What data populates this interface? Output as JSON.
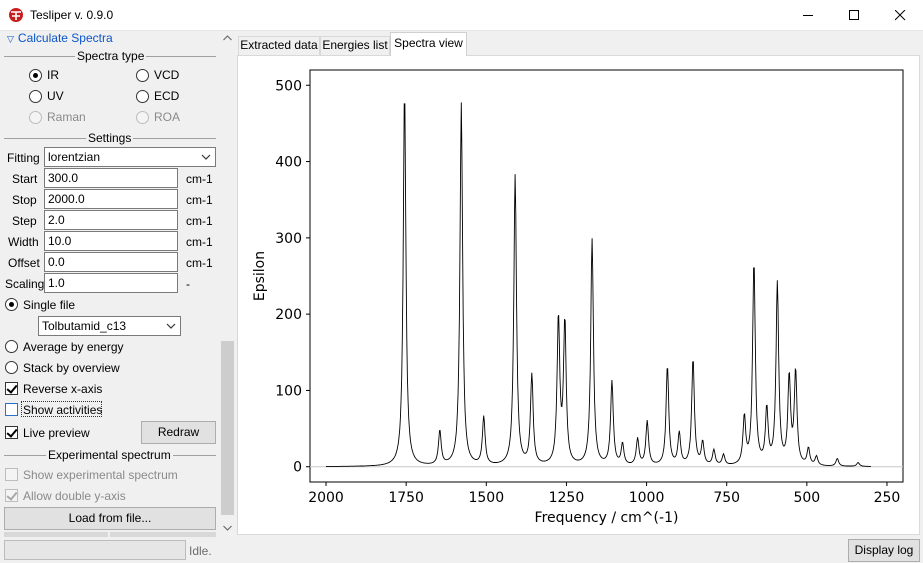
{
  "window": {
    "title": "Tesliper v. 0.9.0",
    "icon": "app-logo-icon"
  },
  "left_panel": {
    "collapse_label": "Calculate Spectra",
    "spectra_type": {
      "title": "Spectra type",
      "options": [
        {
          "label": "IR",
          "checked": true,
          "disabled": false
        },
        {
          "label": "VCD",
          "checked": false,
          "disabled": false
        },
        {
          "label": "UV",
          "checked": false,
          "disabled": false
        },
        {
          "label": "ECD",
          "checked": false,
          "disabled": false
        },
        {
          "label": "Raman",
          "checked": false,
          "disabled": true
        },
        {
          "label": "ROA",
          "checked": false,
          "disabled": true
        }
      ]
    },
    "settings": {
      "title": "Settings",
      "fitting": {
        "label": "Fitting",
        "value": "lorentzian"
      },
      "start": {
        "label": "Start",
        "value": "300.0",
        "unit": "cm-1"
      },
      "stop": {
        "label": "Stop",
        "value": "2000.0",
        "unit": "cm-1"
      },
      "step": {
        "label": "Step",
        "value": "2.0",
        "unit": "cm-1"
      },
      "width": {
        "label": "Width",
        "value": "10.0",
        "unit": "cm-1"
      },
      "offset": {
        "label": "Offset",
        "value": "0.0",
        "unit": "cm-1"
      },
      "scaling": {
        "label": "Scaling",
        "value": "1.0",
        "unit": "-"
      }
    },
    "mode": {
      "single_file": {
        "label": "Single file",
        "checked": true
      },
      "file_select": "Tolbutamid_c13",
      "average": {
        "label": "Average by energy",
        "checked": false
      },
      "stack": {
        "label": "Stack by overview",
        "checked": false
      }
    },
    "reverse_x": {
      "label": "Reverse x-axis",
      "checked": true
    },
    "show_activities": {
      "label": "Show activities",
      "checked": false
    },
    "live_preview": {
      "label": "Live preview",
      "checked": true
    },
    "redraw_label": "Redraw",
    "experimental": {
      "title": "Experimental spectrum",
      "show": {
        "label": "Show experimental spectrum",
        "checked": false
      },
      "double_axis": {
        "label": "Allow double y-axis",
        "checked": true
      },
      "load_label": "Load from file..."
    }
  },
  "tabs": [
    {
      "label": "Extracted data",
      "active": false
    },
    {
      "label": "Energies list",
      "active": false
    },
    {
      "label": "Spectra view",
      "active": true
    }
  ],
  "status": {
    "text": "Idle.",
    "display_log_label": "Display log"
  },
  "chart_data": {
    "type": "line",
    "xlabel": "Frequency / cm^(-1)",
    "ylabel": "Epsilon",
    "xlim": [
      2050,
      200
    ],
    "ylim": [
      -20,
      520
    ],
    "x_reversed": true,
    "x_ticks": [
      2000,
      1750,
      1500,
      1250,
      1000,
      750,
      500,
      250
    ],
    "y_ticks": [
      0,
      100,
      200,
      300,
      400,
      500
    ],
    "grid": false,
    "line_color": "#000000",
    "baseline_color": "#c8c8c8",
    "x_range": [
      300,
      2000
    ],
    "fitting": "lorentzian",
    "width": 10,
    "peaks": [
      {
        "x": 1755,
        "y": 494
      },
      {
        "x": 1645,
        "y": 45
      },
      {
        "x": 1578,
        "y": 476
      },
      {
        "x": 1508,
        "y": 63
      },
      {
        "x": 1410,
        "y": 381
      },
      {
        "x": 1358,
        "y": 118
      },
      {
        "x": 1275,
        "y": 192
      },
      {
        "x": 1255,
        "y": 186
      },
      {
        "x": 1170,
        "y": 297
      },
      {
        "x": 1108,
        "y": 110
      },
      {
        "x": 1075,
        "y": 28
      },
      {
        "x": 1028,
        "y": 35
      },
      {
        "x": 998,
        "y": 58
      },
      {
        "x": 935,
        "y": 131
      },
      {
        "x": 898,
        "y": 42
      },
      {
        "x": 855,
        "y": 140
      },
      {
        "x": 825,
        "y": 30
      },
      {
        "x": 790,
        "y": 20
      },
      {
        "x": 760,
        "y": 14
      },
      {
        "x": 695,
        "y": 62
      },
      {
        "x": 665,
        "y": 266
      },
      {
        "x": 625,
        "y": 72
      },
      {
        "x": 592,
        "y": 238
      },
      {
        "x": 555,
        "y": 114
      },
      {
        "x": 535,
        "y": 122
      },
      {
        "x": 495,
        "y": 22
      },
      {
        "x": 470,
        "y": 12
      },
      {
        "x": 405,
        "y": 10
      },
      {
        "x": 340,
        "y": 5
      }
    ]
  }
}
